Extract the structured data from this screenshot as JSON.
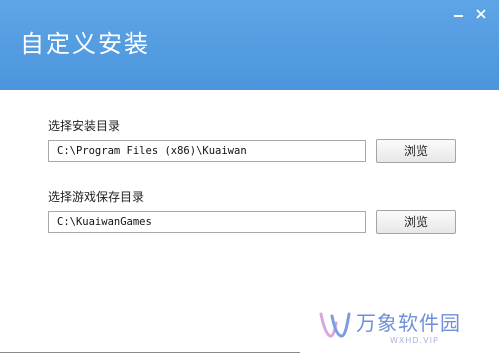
{
  "window": {
    "title": "自定义安装",
    "header_color": "#4f98de",
    "controls": {
      "minimize_icon": "minimize-icon",
      "close_icon": "close-icon"
    }
  },
  "install_dir": {
    "label": "选择安装目录",
    "value": "C:\\Program Files (x86)\\Kuaiwan",
    "browse_label": "浏览"
  },
  "game_dir": {
    "label": "选择游戏保存目录",
    "value": "C:\\KuaiwanGames",
    "browse_label": "浏览"
  },
  "watermark": {
    "logo_icon": "wanxiang-logo-icon",
    "text": "万象软件园",
    "sub": "WXHD.VIP"
  }
}
